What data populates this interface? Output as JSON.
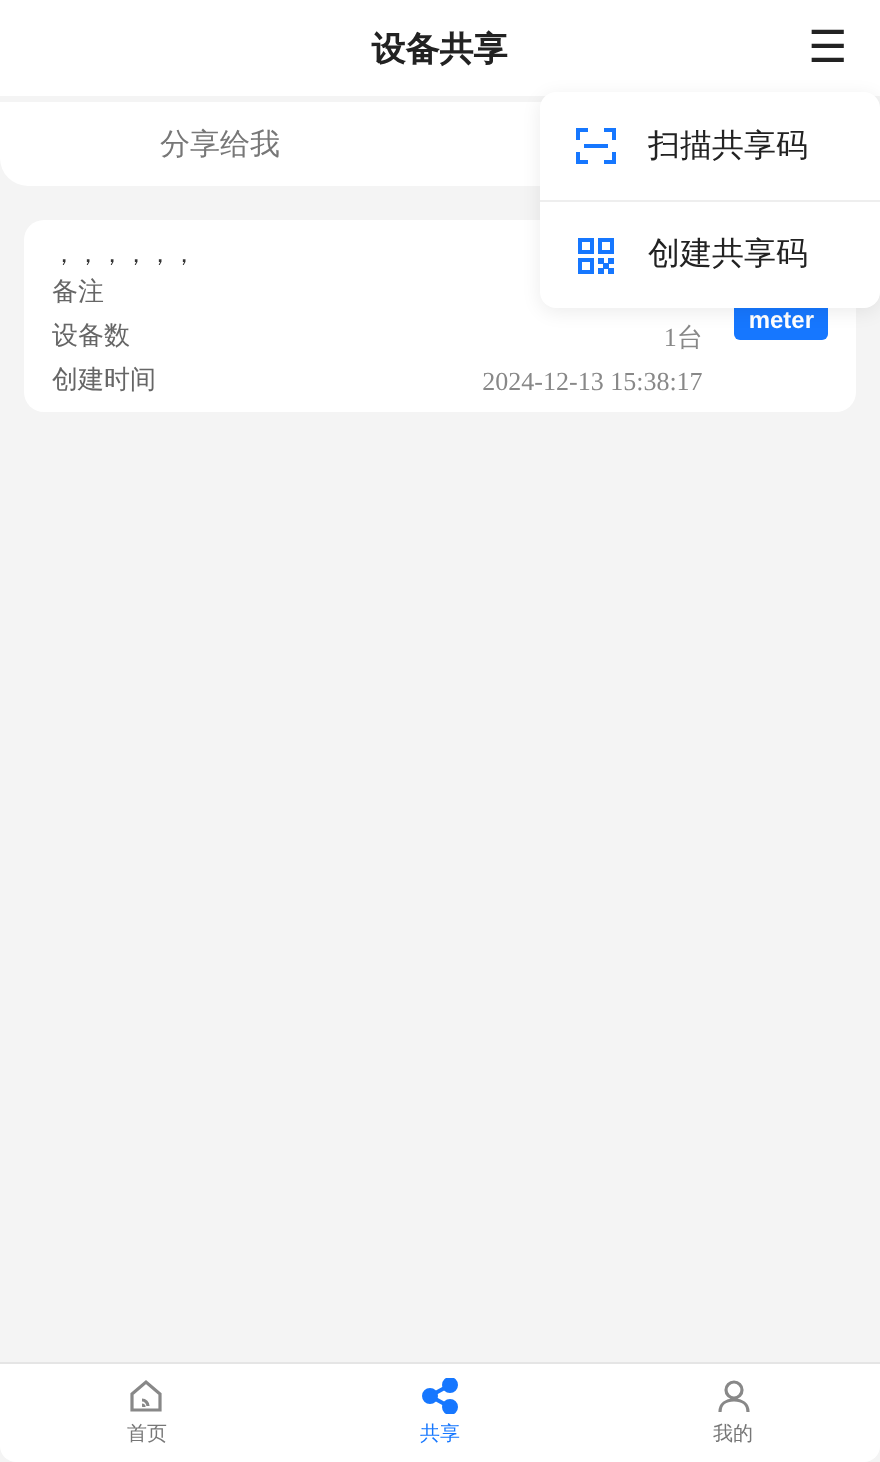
{
  "header": {
    "title": "设备共享",
    "menu_icon": "☰"
  },
  "menu": {
    "items": [
      {
        "kind": "scan",
        "label": "扫描共享码"
      },
      {
        "kind": "qr",
        "label": "创建共享码"
      }
    ]
  },
  "tabs": [
    {
      "label": "分享给我",
      "selected": false
    }
  ],
  "cards": [
    {
      "title": "，，，，，，",
      "button": "meter",
      "rows": [
        {
          "label": "备注",
          "value": ""
        },
        {
          "label": "设备数",
          "value": "1台"
        },
        {
          "label": "创建时间",
          "value": "2024-12-13 15:38:17"
        }
      ]
    }
  ],
  "bottom_nav": [
    {
      "kind": "home",
      "label": "首页",
      "selected": false
    },
    {
      "kind": "share",
      "label": "共享",
      "selected": true
    },
    {
      "kind": "user",
      "label": "我的",
      "selected": false
    }
  ]
}
